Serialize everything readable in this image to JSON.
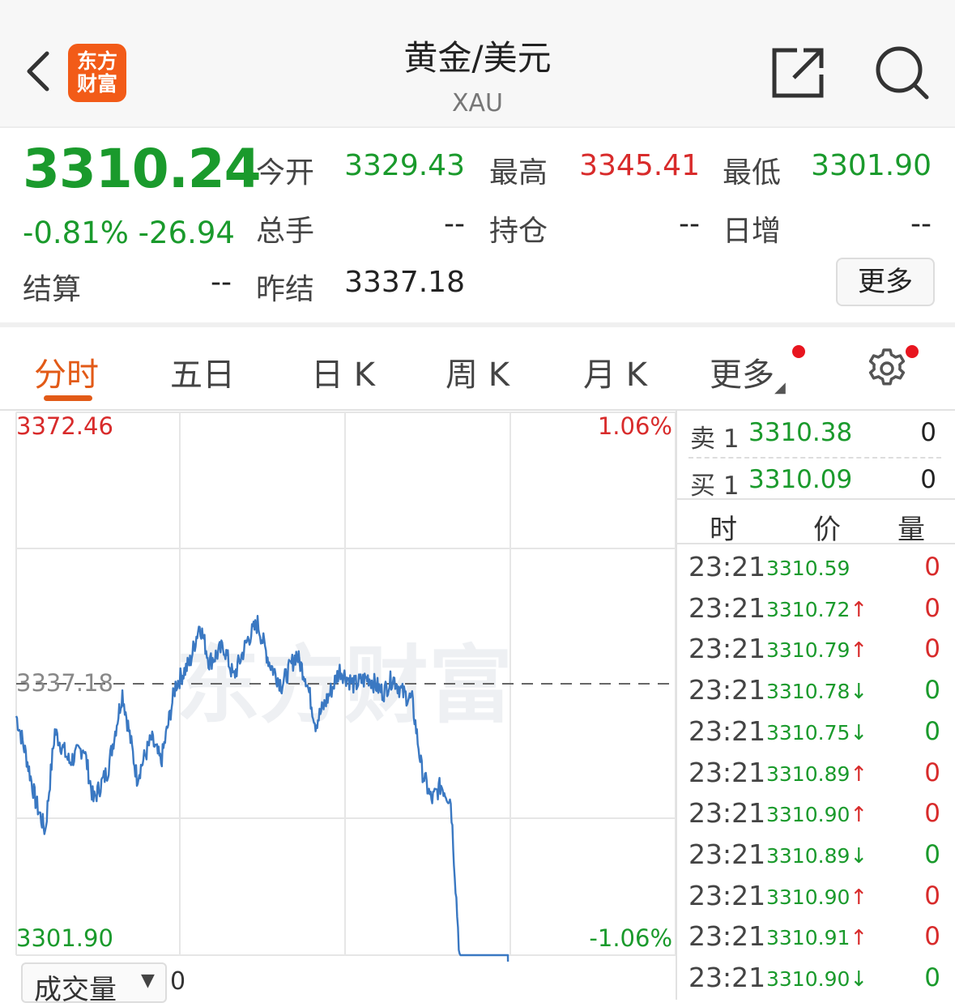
{
  "header": {
    "logo_line1": "东方",
    "logo_line2": "财富",
    "title": "黄金/美元",
    "subtitle": "XAU"
  },
  "quote": {
    "price": "3310.24",
    "change_pct": "-0.81%",
    "change_abs": "-26.94",
    "open_label": "今开",
    "open_value": "3329.43",
    "high_label": "最高",
    "high_value": "3345.41",
    "low_label": "最低",
    "low_value": "3301.90",
    "volume_label": "总手",
    "volume_value": "--",
    "oi_label": "持仓",
    "oi_value": "--",
    "daily_inc_label": "日增",
    "daily_inc_value": "--",
    "settle_label": "结算",
    "settle_value": "--",
    "prev_settle_label": "昨结",
    "prev_settle_value": "3337.18",
    "more_label": "更多"
  },
  "tabs": [
    {
      "label": "分时",
      "active": true
    },
    {
      "label": "五日",
      "active": false
    },
    {
      "label": "日 K",
      "active": false
    },
    {
      "label": "周 K",
      "active": false
    },
    {
      "label": "月 K",
      "active": false
    },
    {
      "label": "更多",
      "active": false
    }
  ],
  "chart_data": {
    "type": "line",
    "ylim": [
      3301.9,
      3372.46
    ],
    "y_max_label": "3372.46",
    "y_min_label": "3301.90",
    "pct_max_label": "1.06%",
    "pct_min_label": "-1.06%",
    "baseline": 3337.18,
    "baseline_label": "3337.18",
    "watermark": "东方财富",
    "series_color": "#3a78c2",
    "anchors": [
      [
        0,
        3333
      ],
      [
        10,
        3328
      ],
      [
        20,
        3322
      ],
      [
        30,
        3318
      ],
      [
        40,
        3331
      ],
      [
        55,
        3327
      ],
      [
        70,
        3329
      ],
      [
        80,
        3322
      ],
      [
        95,
        3326
      ],
      [
        110,
        3336
      ],
      [
        125,
        3325
      ],
      [
        140,
        3330
      ],
      [
        150,
        3327
      ],
      [
        165,
        3337
      ],
      [
        180,
        3340
      ],
      [
        190,
        3345
      ],
      [
        200,
        3340
      ],
      [
        215,
        3342
      ],
      [
        225,
        3338
      ],
      [
        240,
        3343
      ],
      [
        250,
        3345
      ],
      [
        262,
        3340
      ],
      [
        275,
        3337
      ],
      [
        290,
        3341
      ],
      [
        300,
        3338
      ],
      [
        310,
        3332
      ],
      [
        325,
        3336
      ],
      [
        335,
        3339
      ],
      [
        350,
        3337
      ],
      [
        365,
        3338
      ],
      [
        380,
        3336
      ],
      [
        390,
        3338
      ],
      [
        400,
        3336
      ],
      [
        410,
        3335
      ],
      [
        420,
        3326
      ],
      [
        430,
        3322
      ],
      [
        440,
        3324
      ],
      [
        450,
        3322
      ],
      [
        460,
        3300
      ],
      [
        470,
        3285
      ],
      [
        480,
        3292
      ],
      [
        490,
        3287
      ],
      [
        500,
        3292
      ],
      [
        510,
        3292
      ]
    ]
  },
  "orderbook": {
    "ask_label": "卖 1",
    "ask_price": "3310.38",
    "ask_qty": "0",
    "bid_label": "买 1",
    "bid_price": "3310.09",
    "bid_qty": "0"
  },
  "ticks_header": {
    "time": "时",
    "price": "价",
    "qty": "量"
  },
  "ticks": [
    {
      "time": "23:21",
      "price": "3310.59",
      "arrow": "",
      "qty": "0",
      "color": "red"
    },
    {
      "time": "23:21",
      "price": "3310.72",
      "arrow": "↑",
      "qty": "0",
      "color": "red"
    },
    {
      "time": "23:21",
      "price": "3310.79",
      "arrow": "↑",
      "qty": "0",
      "color": "red"
    },
    {
      "time": "23:21",
      "price": "3310.78",
      "arrow": "↓",
      "qty": "0",
      "color": "green"
    },
    {
      "time": "23:21",
      "price": "3310.75",
      "arrow": "↓",
      "qty": "0",
      "color": "green"
    },
    {
      "time": "23:21",
      "price": "3310.89",
      "arrow": "↑",
      "qty": "0",
      "color": "red"
    },
    {
      "time": "23:21",
      "price": "3310.90",
      "arrow": "↑",
      "qty": "0",
      "color": "red"
    },
    {
      "time": "23:21",
      "price": "3310.89",
      "arrow": "↓",
      "qty": "0",
      "color": "green"
    },
    {
      "time": "23:21",
      "price": "3310.90",
      "arrow": "↑",
      "qty": "0",
      "color": "red"
    },
    {
      "time": "23:21",
      "price": "3310.91",
      "arrow": "↑",
      "qty": "0",
      "color": "red"
    },
    {
      "time": "23:21",
      "price": "3310.90",
      "arrow": "↓",
      "qty": "0",
      "color": "green"
    }
  ],
  "volume": {
    "select_label": "成交量",
    "value": "0"
  },
  "colors": {
    "up": "#d82b2b",
    "down": "#1a9a2c",
    "accent": "#e25a17"
  }
}
